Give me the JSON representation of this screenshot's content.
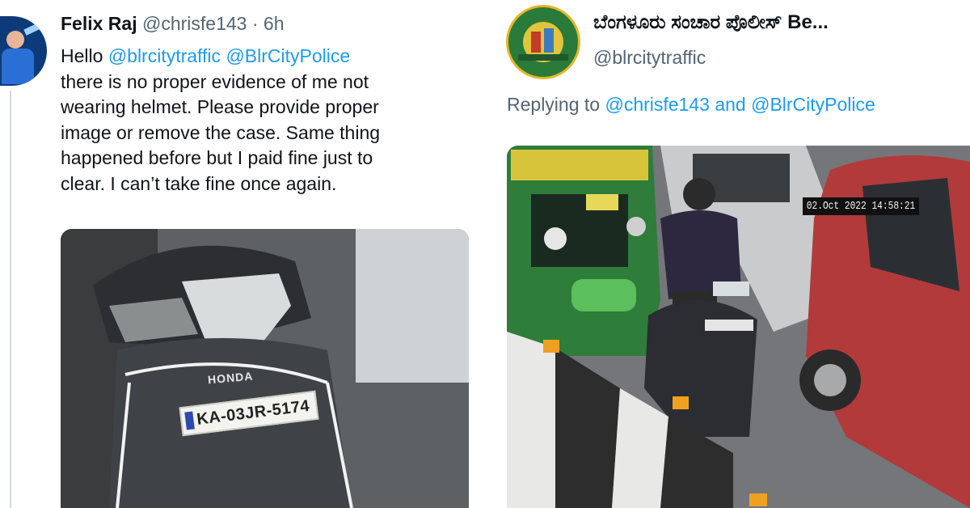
{
  "left_tweet": {
    "display_name": "Felix Raj",
    "handle": "@chrisfe143",
    "separator": "·",
    "time": "6h",
    "text_lines": [
      {
        "prefix": "Hello ",
        "mentions": [
          "@blrcitytraffic",
          "@BlrCityPolice"
        ]
      },
      "there is no proper evidence of me not",
      "wearing helmet.  Please provide proper",
      "image or remove the case.   Same thing",
      "happened before but I paid fine just to",
      "clear. I can’t take fine once again."
    ],
    "photo": {
      "brand_text": "HONDA",
      "plate_text": "KA-03JR-5174"
    }
  },
  "right_tweet": {
    "display_name": "ಬೆಂಗಳೂರು ಸಂಚಾರ ಪೊಲೀಸ್ Be...",
    "handle": "@blrcitytraffic",
    "reply_prefix": "Replying to ",
    "reply_mentions": [
      "@chrisfe143",
      "@BlrCityPolice"
    ],
    "reply_joiner": " and ",
    "photo": {
      "timestamp": "02.Oct 2022  14:58:21"
    }
  },
  "colors": {
    "mention": "#1d9bf0",
    "secondary_text": "#536471",
    "primary_text": "#0f1419"
  }
}
